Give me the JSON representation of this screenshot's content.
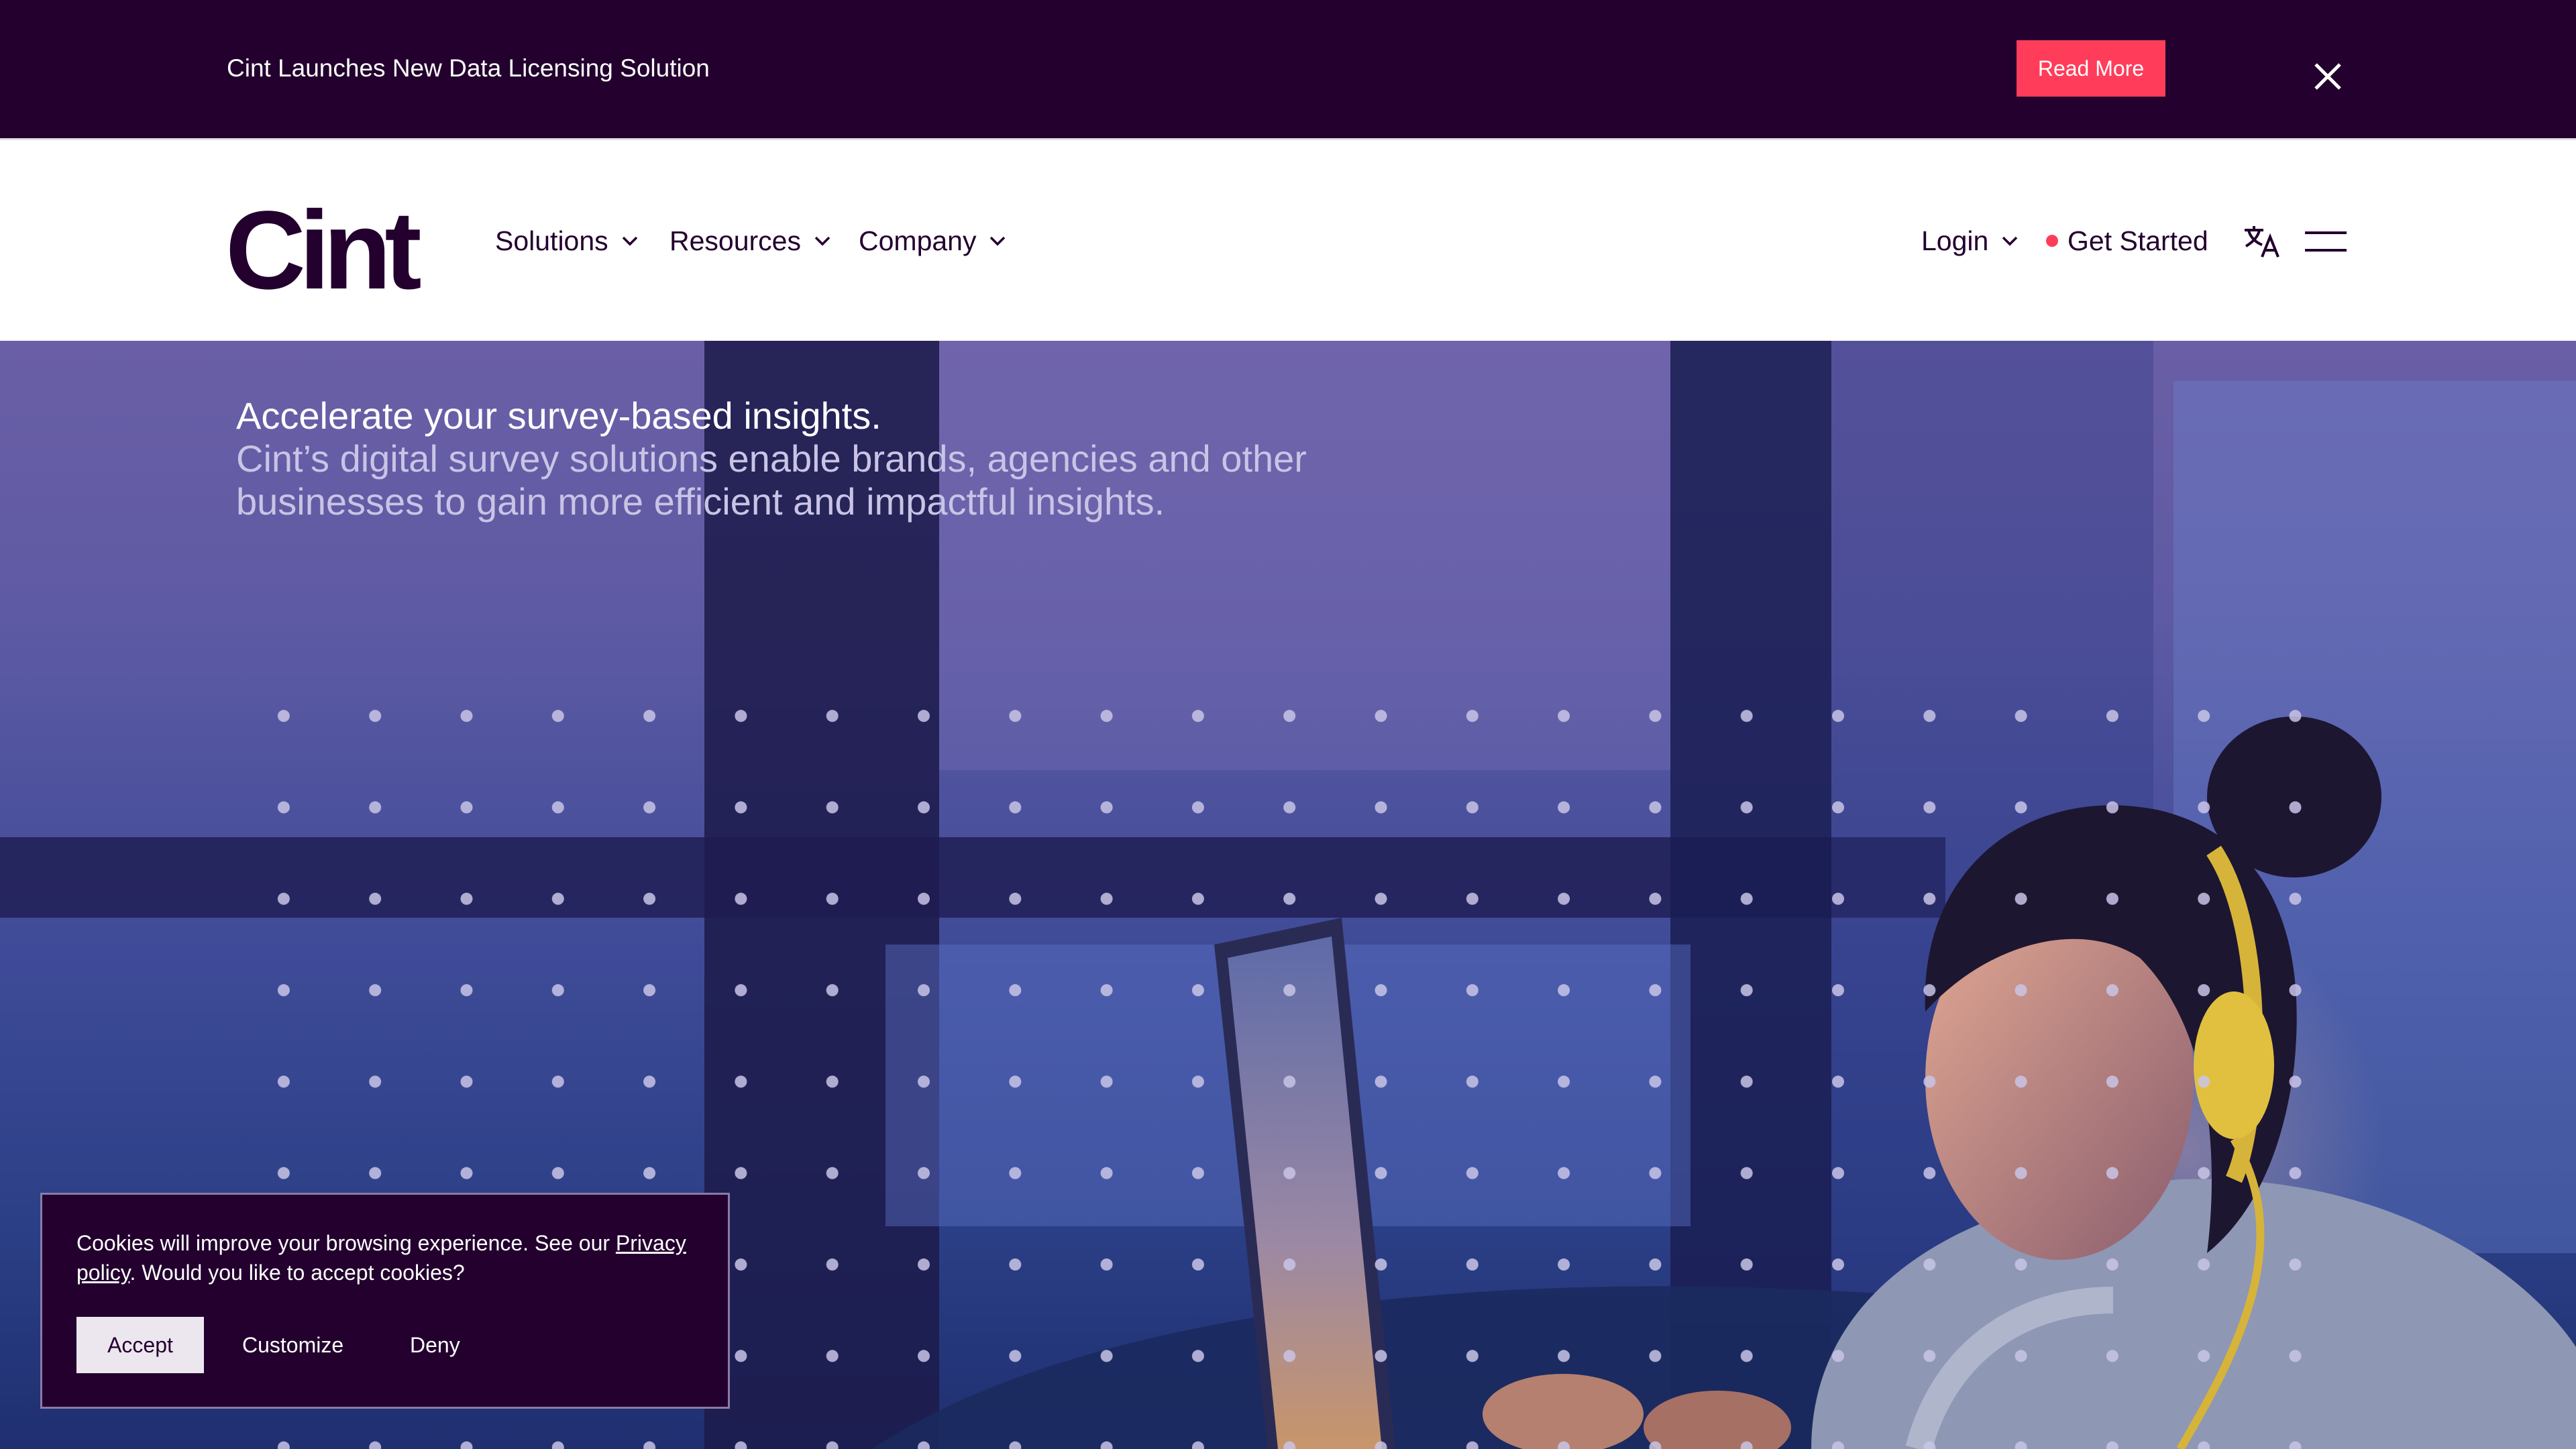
{
  "announcement": {
    "text": "Cint Launches New Data Licensing Solution",
    "button_label": "Read More",
    "close_icon": "close-icon"
  },
  "header": {
    "logo_text": "Cint",
    "nav": [
      {
        "label": "Solutions",
        "icon": "chevron-down-icon"
      },
      {
        "label": "Resources",
        "icon": "chevron-down-icon"
      },
      {
        "label": "Company",
        "icon": "chevron-down-icon"
      }
    ],
    "login_label": "Login",
    "get_started_label": "Get Started",
    "language_icon": "translate-icon",
    "menu_icon": "hamburger-menu-icon"
  },
  "hero": {
    "title": "Accelerate your survey-based insights.",
    "subtitle": "Cint’s digital survey solutions enable brands, agencies and other businesses to gain more efficient and impactful insights."
  },
  "cookie": {
    "text_before": "Cookies will improve your browsing experience. See our ",
    "link_label": "Privacy policy",
    "text_after": ". Would you like to accept cookies?",
    "accept_label": "Accept",
    "customize_label": "Customize",
    "deny_label": "Deny"
  },
  "colors": {
    "brand_dark": "#23002e",
    "accent": "#ff3d5a",
    "white": "#ffffff"
  }
}
